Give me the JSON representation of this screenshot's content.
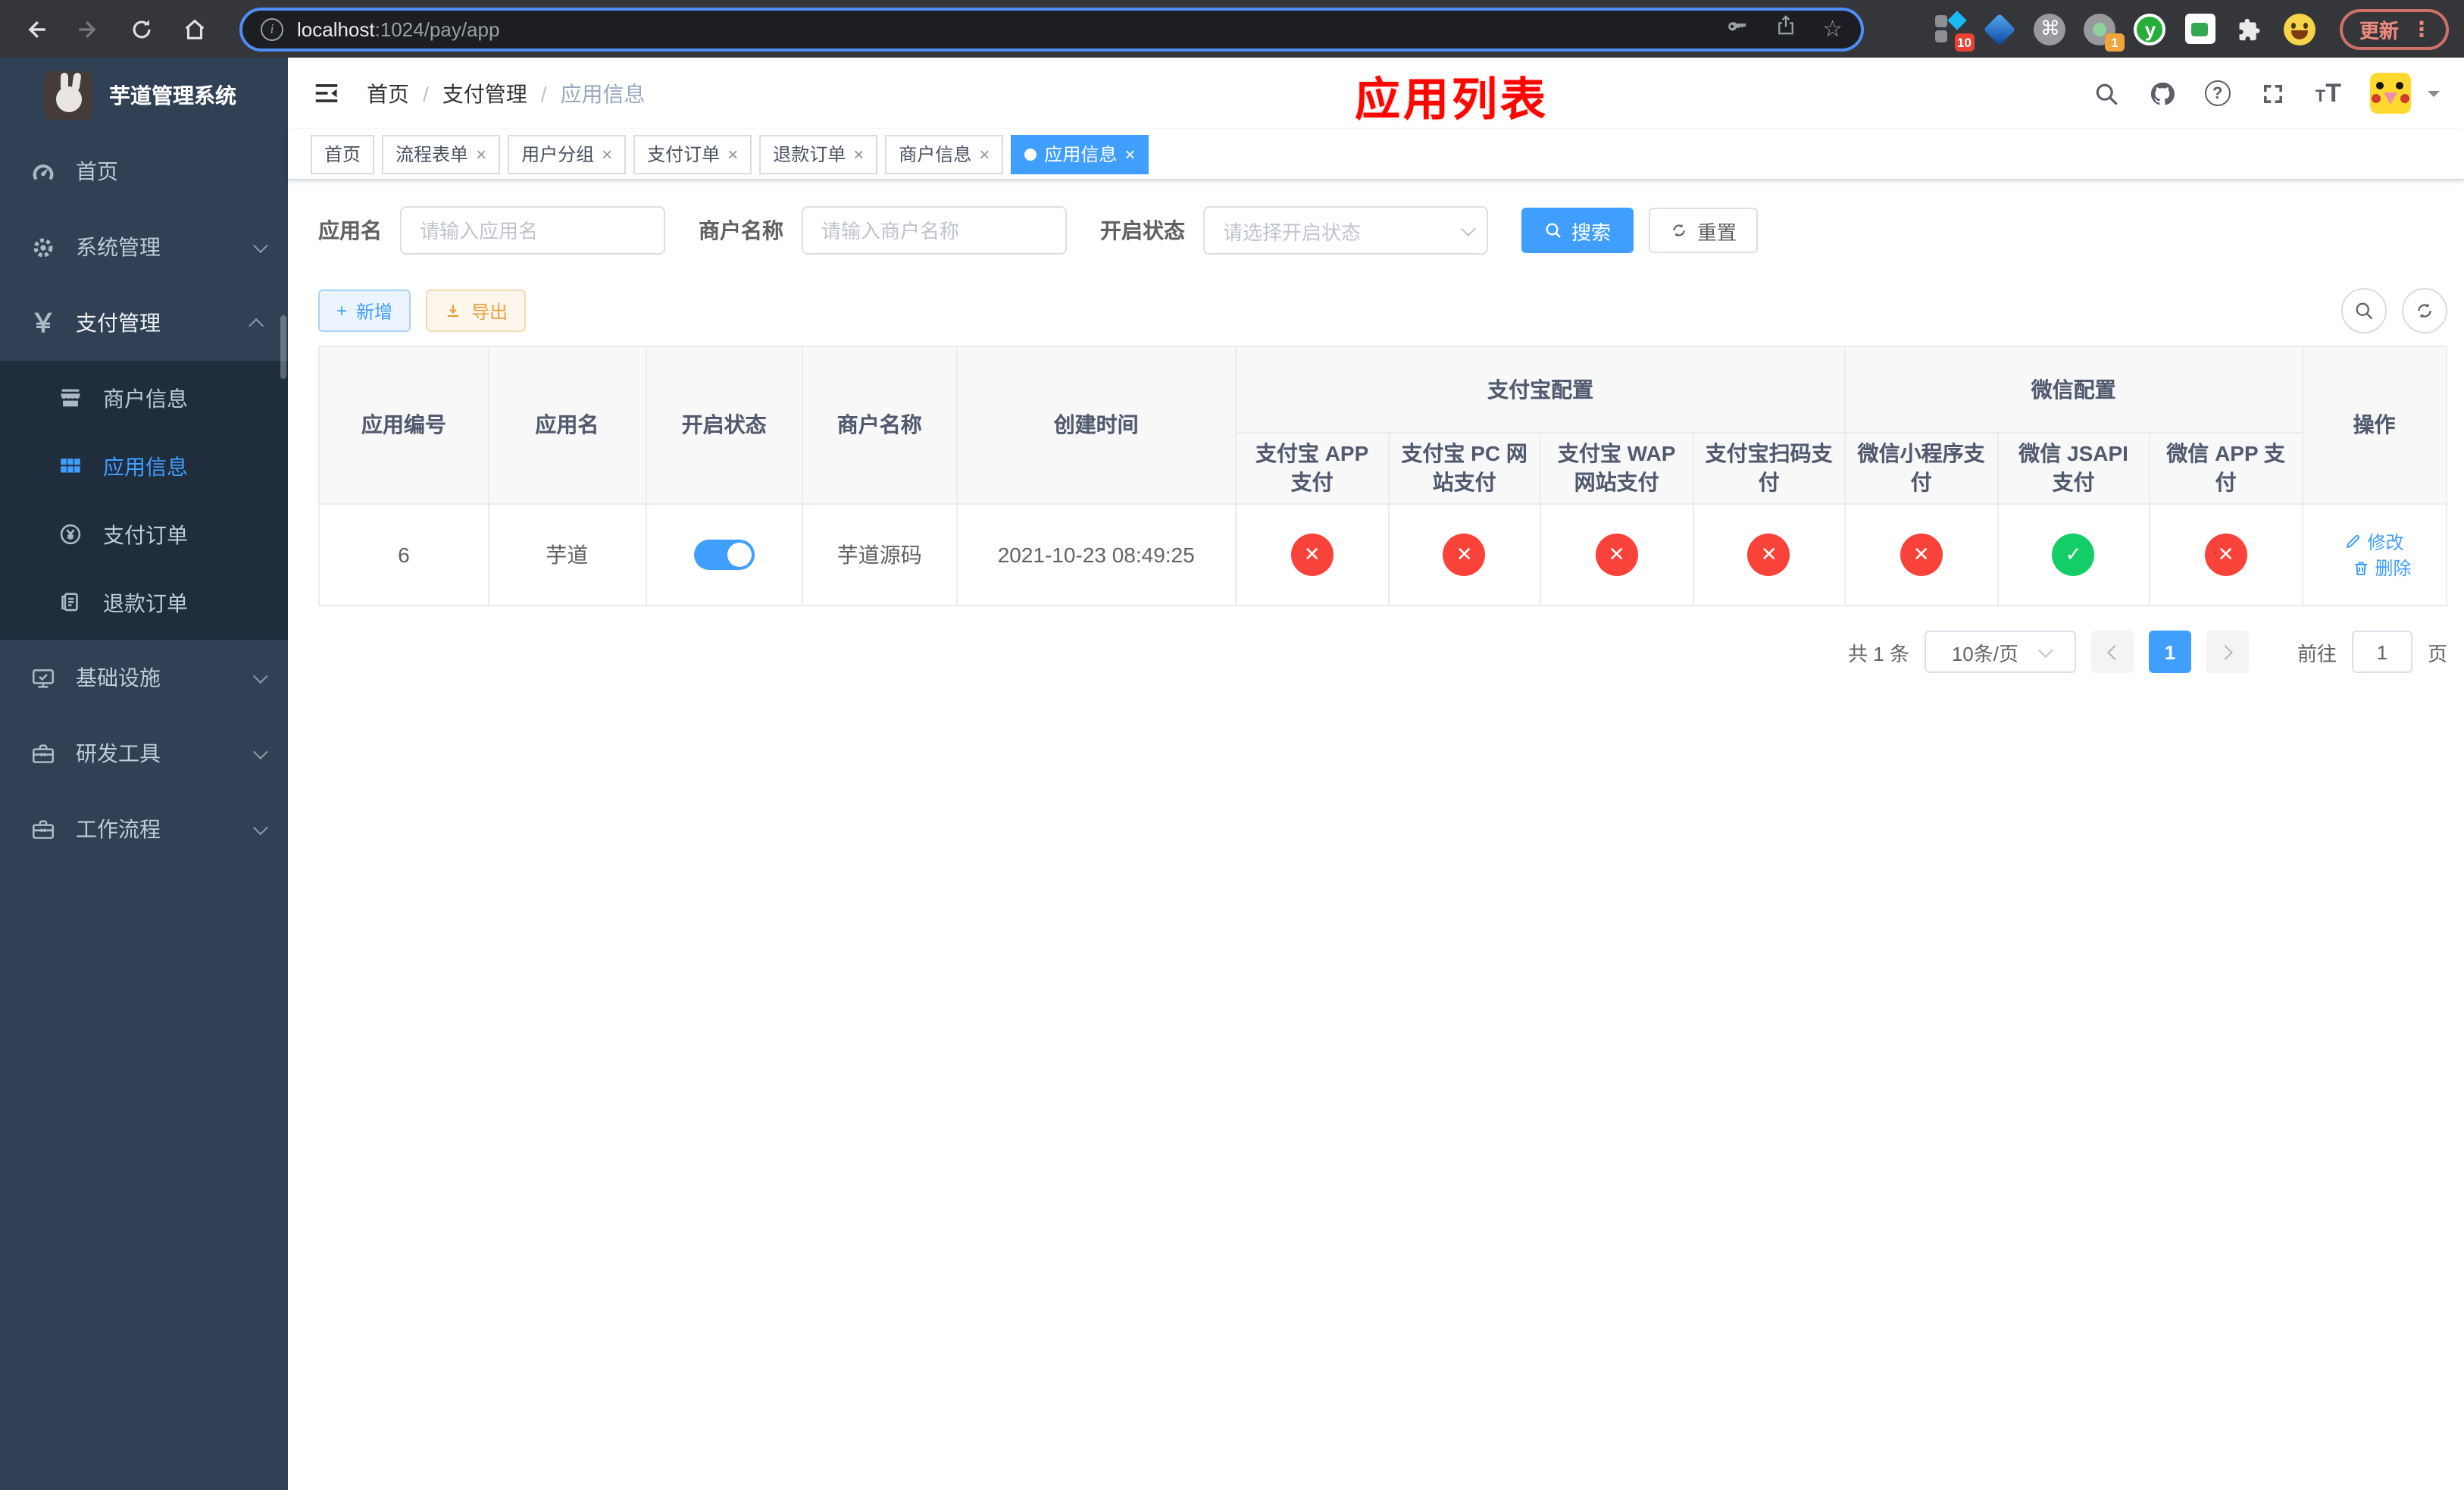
{
  "browser": {
    "url_host": "localhost",
    "url_rest": ":1024/pay/app",
    "update_button": "更新",
    "ext_badge_count": "10",
    "ext_badge_one": "1"
  },
  "icons": {
    "yen": "￥",
    "plus": "+",
    "close": "×",
    "check": "✓",
    "cross": "✕",
    "breadcrumb_sep": "/",
    "help": "?",
    "info": "i",
    "star": "☆",
    "command": "⌘",
    "y_logo": "y",
    "font_glyph": "T",
    "dots_vertical": "⋮"
  },
  "sidebar": {
    "title": "芋道管理系统",
    "menu": [
      {
        "label": "首页"
      },
      {
        "label": "系统管理"
      },
      {
        "label": "支付管理"
      }
    ],
    "submenu": [
      {
        "label": "商户信息"
      },
      {
        "label": "应用信息"
      },
      {
        "label": "支付订单"
      },
      {
        "label": "退款订单"
      }
    ],
    "menu_bottom": [
      {
        "label": "基础设施"
      },
      {
        "label": "研发工具"
      },
      {
        "label": "工作流程"
      }
    ]
  },
  "header": {
    "breadcrumb": [
      "首页",
      "支付管理",
      "应用信息"
    ],
    "page_banner": "应用列表"
  },
  "tags": [
    {
      "label": "首页"
    },
    {
      "label": "流程表单"
    },
    {
      "label": "用户分组"
    },
    {
      "label": "支付订单"
    },
    {
      "label": "退款订单"
    },
    {
      "label": "商户信息"
    },
    {
      "label": "应用信息"
    }
  ],
  "filters": {
    "app_name_label": "应用名",
    "app_name_placeholder": "请输入应用名",
    "merchant_label": "商户名称",
    "merchant_placeholder": "请输入商户名称",
    "status_label": "开启状态",
    "status_placeholder": "请选择开启状态",
    "search_button": "搜索",
    "reset_button": "重置"
  },
  "toolbar": {
    "add_button": "新增",
    "export_button": "导出"
  },
  "table": {
    "columns": [
      "应用编号",
      "应用名",
      "开启状态",
      "商户名称",
      "创建时间"
    ],
    "group_alipay": "支付宝配置",
    "group_wechat": "微信配置",
    "alipay_cols": [
      "支付宝 APP 支付",
      "支付宝 PC 网站支付",
      "支付宝 WAP 网站支付",
      "支付宝扫码支付"
    ],
    "wechat_cols": [
      "微信小程序支付",
      "微信 JSAPI 支付",
      "微信 APP 支付"
    ],
    "ops_col": "操作",
    "rows": [
      {
        "id": "6",
        "name": "芋道",
        "enabled": true,
        "merchant": "芋道源码",
        "created": "2021-10-23 08:49:25",
        "channels": [
          "no",
          "no",
          "no",
          "no",
          "no",
          "yes",
          "no"
        ],
        "edit": "修改",
        "delete": "删除"
      }
    ]
  },
  "pagination": {
    "total": "共 1 条",
    "page_size": "10条/页",
    "current_page": "1",
    "goto_label": "前往",
    "goto_value": "1",
    "goto_suffix": "页"
  },
  "colors": {
    "accent": "#409eff",
    "success": "#13ce66",
    "danger": "#f9423a",
    "warning": "#e6a23c",
    "sidebar_bg": "#304156",
    "submenu_bg": "#1f2d3d",
    "banner_red": "#fe0600"
  }
}
